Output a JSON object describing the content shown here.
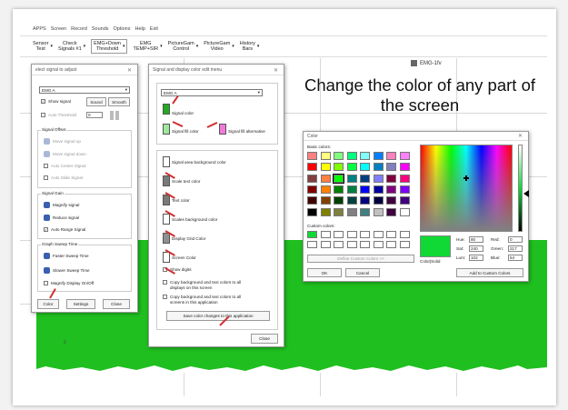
{
  "menu": [
    "APPS",
    "Screen",
    "Record",
    "Sounds",
    "Options",
    "Help",
    "Exit"
  ],
  "toolbar": [
    {
      "label": "Sensor\nTest"
    },
    {
      "label": "Check\nSignals #1"
    },
    {
      "label": "EMG+Down\nThreshold"
    },
    {
      "label": "EMG\nTEMP+SIR"
    },
    {
      "label": "PictureGam\nControl"
    },
    {
      "label": "PictureGam\nVideo"
    },
    {
      "label": "History\nBars"
    }
  ],
  "legend_label": "EMG-1fv",
  "caption": "Change the color of any part of the screen",
  "axis_number": "2",
  "select_dialog": {
    "title": "elect signal to adjust",
    "channel": "EMG A",
    "show_signal": "Show signal",
    "sound": "Sound",
    "smooth": "Smooth",
    "auto_threshold": "Auto Threshold",
    "threshold_value": "0",
    "offset_group": "Signal Offset",
    "offset_items": [
      "Move signal up",
      "Move signal down",
      "Auto Center Signal",
      "Auto Slide Signal"
    ],
    "gain_group": "Signal Gain",
    "magnify": "Magnify signal",
    "reduce": "Reduce signal",
    "auto_range": "Auto Range Signal",
    "sweep_group": "Graph Sweep Time",
    "faster": "Faster Sweep Time",
    "slower": "Slower Sweep Time",
    "magnify_onoff": "Magnify Display On/Off",
    "color_btn": "Color",
    "settings_btn": "Settings",
    "close_btn": "Close"
  },
  "color_menu": {
    "title": "Signal and display color edit menu",
    "channel": "EMG A",
    "signal_color": "Signal color",
    "signal_fill": "Signal fill color",
    "signal_fill_alt": "Signal fill alternative",
    "items": [
      "Signal area background color",
      "Scale text color",
      "Text color",
      "Scales background color",
      "Display Grid Color",
      "Screen Color"
    ],
    "show_digits": "Show digits",
    "copy1_line1": "Copy background and text colors to all",
    "copy1_line2": "displays on this screen",
    "copy2_line1": "Copy background and text colors to all",
    "copy2_line2": "screens in this application",
    "save_btn": "Save color changes to this application",
    "close_btn": "Close",
    "colors": {
      "signal": "#22aa22",
      "fill": "#9de89d",
      "fill_alt": "#f07ad8",
      "swatch_white": "#ffffff",
      "swatch_gray": "#7a7a7a",
      "swatch_gray2": "#909090"
    }
  },
  "color_picker": {
    "title": "Color",
    "basic_label": "Basic colors:",
    "custom_label": "Custom colors:",
    "define_btn": "Define Custom Colors >>",
    "ok_btn": "OK",
    "cancel_btn": "Cancel",
    "add_btn": "Add to Custom Colors",
    "color_solid": "Color|Solid",
    "hue_label": "Hue:",
    "hue": "80",
    "sat_label": "Sat:",
    "sat": "240",
    "lum_label": "Lum:",
    "lum": "102",
    "red_label": "Red:",
    "red": "0",
    "green_label": "Green:",
    "green": "217",
    "blue_label": "Blue:",
    "blue": "54",
    "selected_color": "#10d936",
    "basic_colors": [
      "#ff8080",
      "#ffff80",
      "#80ff80",
      "#00ff80",
      "#80ffff",
      "#0080ff",
      "#ff80c0",
      "#ff80ff",
      "#ff0000",
      "#ffff00",
      "#80ff00",
      "#00ff40",
      "#00ffff",
      "#0080c0",
      "#8080c0",
      "#ff00ff",
      "#804040",
      "#ff8040",
      "#00ff00",
      "#008080",
      "#004080",
      "#8080ff",
      "#800040",
      "#ff0080",
      "#800000",
      "#ff8000",
      "#008000",
      "#008040",
      "#0000ff",
      "#0000a0",
      "#800080",
      "#8000ff",
      "#400000",
      "#804000",
      "#004000",
      "#004040",
      "#000080",
      "#000040",
      "#400040",
      "#400080",
      "#000000",
      "#808000",
      "#808040",
      "#808080",
      "#408080",
      "#c0c0c0",
      "#400040",
      "#ffffff"
    ],
    "custom_colors": [
      "#10d936",
      "#ffffff",
      "#ffffff",
      "#ffffff",
      "#ffffff",
      "#ffffff",
      "#ffffff",
      "#ffffff",
      "#ffffff",
      "#ffffff",
      "#ffffff",
      "#ffffff",
      "#ffffff",
      "#ffffff",
      "#ffffff",
      "#ffffff"
    ]
  }
}
